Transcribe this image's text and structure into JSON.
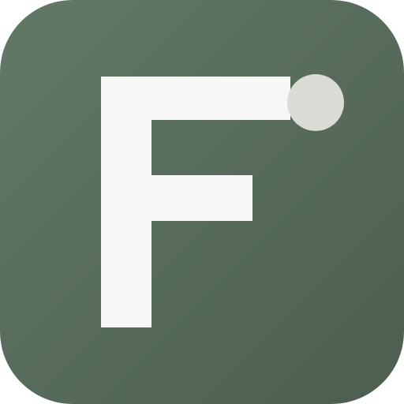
{
  "icon": {
    "letter": "F",
    "colors": {
      "background_light": "#637868",
      "background_dark": "#4c5e50",
      "glyph": "#f7f7f7",
      "dot": "#dcdcd6"
    }
  }
}
